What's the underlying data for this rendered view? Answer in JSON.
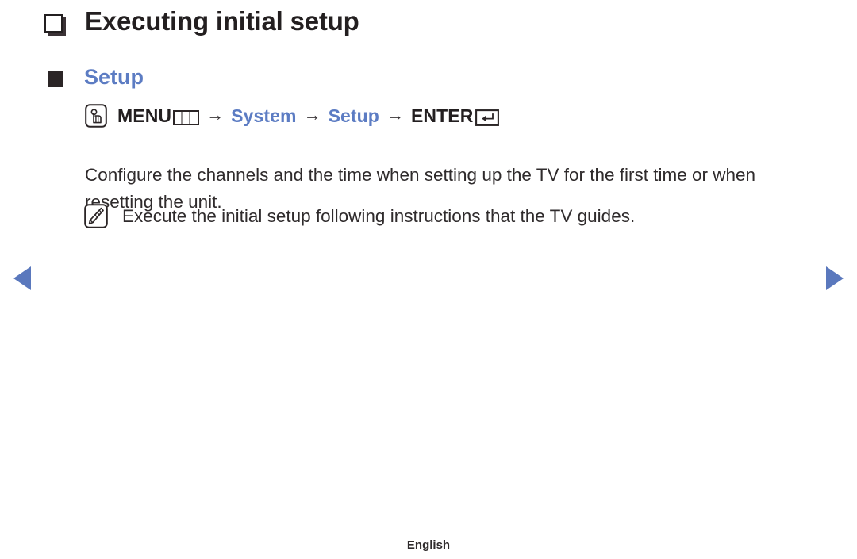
{
  "title": {
    "text": "Executing initial setup",
    "bullet_icon": "hollow-square-icon"
  },
  "section": {
    "heading": "Setup",
    "bullet_icon": "filled-square-icon",
    "heading_color": "#5c7cc3"
  },
  "menu_path": {
    "touch_icon": "hand-touch-icon",
    "menu_label": "MENU",
    "menu_grid_icon": "menu-grid-icon",
    "arrow": "→",
    "step_system": "System",
    "step_setup": "Setup",
    "enter_label": "ENTER",
    "enter_icon": "enter-return-icon"
  },
  "body": {
    "paragraph": "Configure the channels and the time when setting up the TV for the first time or when resetting the unit."
  },
  "note": {
    "icon": "note-pencil-icon",
    "text": "Execute the initial setup following instructions that the TV guides."
  },
  "navigation": {
    "prev_icon": "triangle-left-icon",
    "next_icon": "triangle-right-icon",
    "arrow_color": "#5a78bd"
  },
  "footer": {
    "language": "English"
  }
}
